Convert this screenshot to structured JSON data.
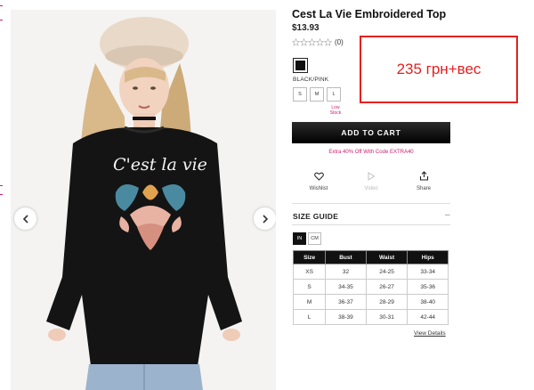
{
  "product": {
    "title": "Cest La Vie Embroidered Top",
    "price": "$13.93",
    "rating_stars": 0,
    "review_count": "(0)",
    "color_name": "BLACK/PINK",
    "sizes": [
      "S",
      "M",
      "L"
    ],
    "selected_color": "#111111",
    "low_stock_label": "Low Stock"
  },
  "gallery": {
    "prev_icon": "chevron-left-icon",
    "next_icon": "chevron-right-icon",
    "print_text": "C'est la vie"
  },
  "cart": {
    "add_to_cart_label": "ADD TO CART",
    "promo_text": "Extra 40% Off With Code EXTRA40"
  },
  "actions": {
    "wishlist_label": "Wishlist",
    "video_label": "Video",
    "share_label": "Share"
  },
  "size_guide": {
    "title": "SIZE GUIDE",
    "toggle": "–",
    "units": [
      "IN",
      "CM"
    ],
    "active_unit": "IN",
    "headers": [
      "Size",
      "Bust",
      "Waist",
      "Hips"
    ],
    "rows": [
      [
        "XS",
        "32",
        "24-25",
        "33-34"
      ],
      [
        "S",
        "34-35",
        "26-27",
        "35-36"
      ],
      [
        "M",
        "36-37",
        "28-29",
        "38-40"
      ],
      [
        "L",
        "38-39",
        "30-31",
        "42-44"
      ]
    ],
    "view_details": "View Details"
  },
  "annotation": {
    "text": "235 грн+вес",
    "color": "#e62020"
  },
  "colors": {
    "accent": "#d11d6f",
    "button": "#111111"
  }
}
